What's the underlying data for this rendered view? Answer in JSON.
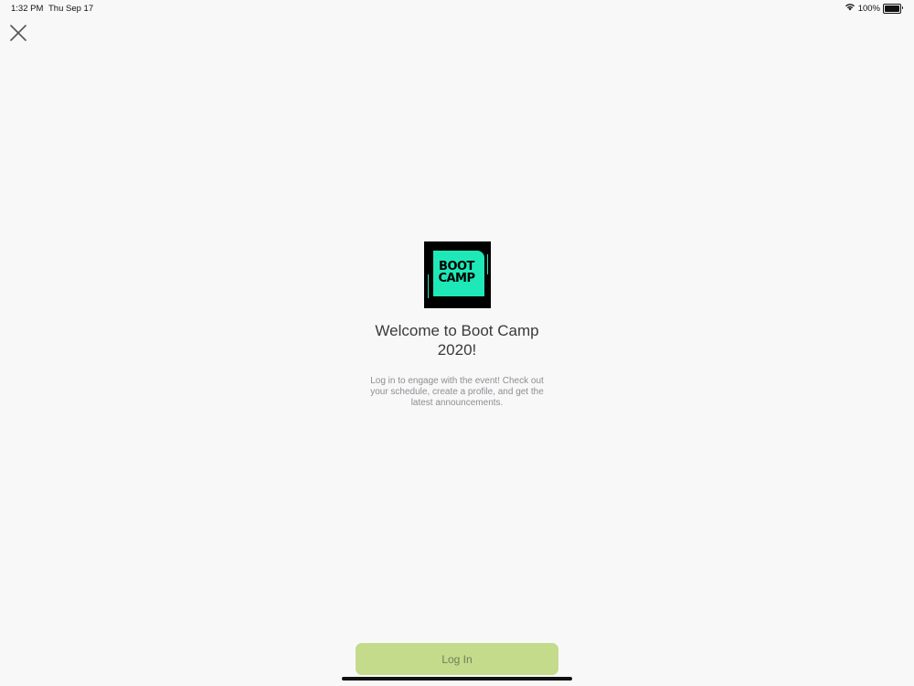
{
  "status_bar": {
    "time": "1:32 PM",
    "date": "Thu Sep 17",
    "battery_percent": "100%",
    "battery_level": 1.0,
    "icons": [
      "wifi-icon",
      "battery-icon"
    ]
  },
  "close": {
    "icon": "close-icon"
  },
  "logo": {
    "text_line1": "BOOT",
    "text_line2": "CAMP",
    "accent_color": "#1ee8b8",
    "background_color": "#000000"
  },
  "welcome": {
    "title": "Welcome to Boot Camp 2020!",
    "subtitle": "Log in to engage with the event! Check out your schedule, create a profile, and get the latest announcements."
  },
  "login_button": {
    "label": "Log In",
    "color": "#c3db8a"
  }
}
